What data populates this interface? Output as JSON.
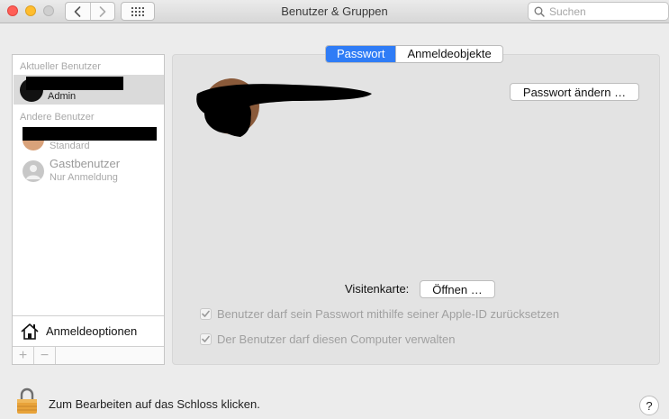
{
  "window": {
    "title": "Benutzer & Gruppen",
    "search_placeholder": "Suchen"
  },
  "sidebar": {
    "current_header": "Aktueller Benutzer",
    "current_user": {
      "role": "Admin"
    },
    "other_header": "Andere Benutzer",
    "other_users": [
      {
        "role": "Standard"
      },
      {
        "name": "Gastbenutzer",
        "role": "Nur Anmeldung"
      }
    ],
    "login_options_label": "Anmeldeoptionen",
    "add_symbol": "+",
    "remove_symbol": "−"
  },
  "main": {
    "tabs": [
      {
        "label": "Passwort",
        "active": true
      },
      {
        "label": "Anmeldeobjekte",
        "active": false
      }
    ],
    "change_password_label": "Passwort ändern …",
    "business_card_label": "Visitenkarte:",
    "open_label": "Öffnen …",
    "checkboxes": [
      {
        "label": "Benutzer darf sein Passwort mithilfe seiner Apple-ID zurücksetzen",
        "checked": true,
        "enabled": false
      },
      {
        "label": "Der Benutzer darf diesen Computer verwalten",
        "checked": true,
        "enabled": false
      }
    ]
  },
  "footer": {
    "lock_text": "Zum Bearbeiten auf das Schloss klicken.",
    "help_label": "?"
  },
  "colors": {
    "accent": "#2f7cf6",
    "lock": "#e8a33a"
  }
}
